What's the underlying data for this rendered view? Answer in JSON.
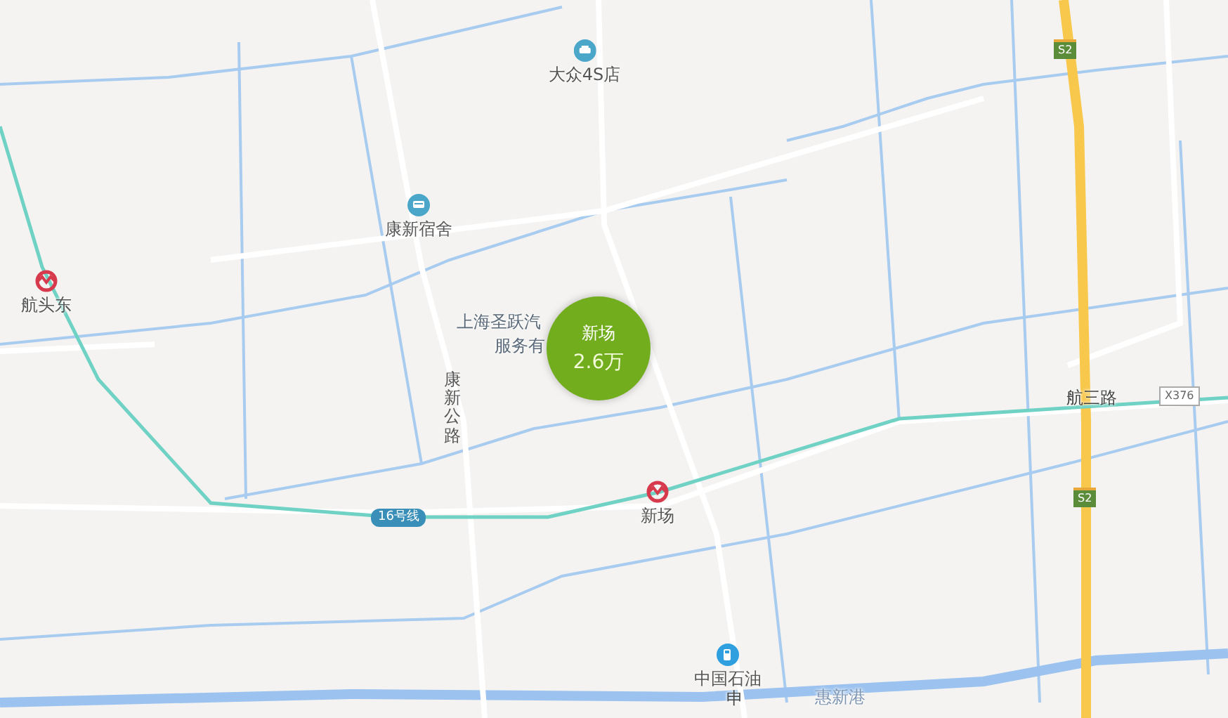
{
  "map": {
    "pois": [
      {
        "kind": "car",
        "name": "大众4S店"
      },
      {
        "kind": "lodging",
        "name": "康新宿舍"
      },
      {
        "kind": "metro",
        "name": "航头东"
      },
      {
        "kind": "metro",
        "name": "新场"
      },
      {
        "kind": "fuel",
        "name": "中国石油"
      }
    ],
    "place_labels": [
      {
        "kind": "poi",
        "text": "上海圣跃汽"
      },
      {
        "kind": "poi",
        "text": "服务有"
      },
      {
        "kind": "water",
        "text": "惠新港"
      },
      {
        "kind": "road",
        "text": "航三路"
      },
      {
        "kind": "road",
        "text": "申"
      }
    ],
    "vertical_road_label": "康新公路",
    "line_badge": "16号线",
    "shields": [
      {
        "kind": "highway",
        "text": "S2"
      },
      {
        "kind": "highway",
        "text": "S2"
      },
      {
        "kind": "county",
        "text": "X376"
      }
    ],
    "cluster": {
      "name": "新场",
      "count": "2.6万"
    }
  }
}
